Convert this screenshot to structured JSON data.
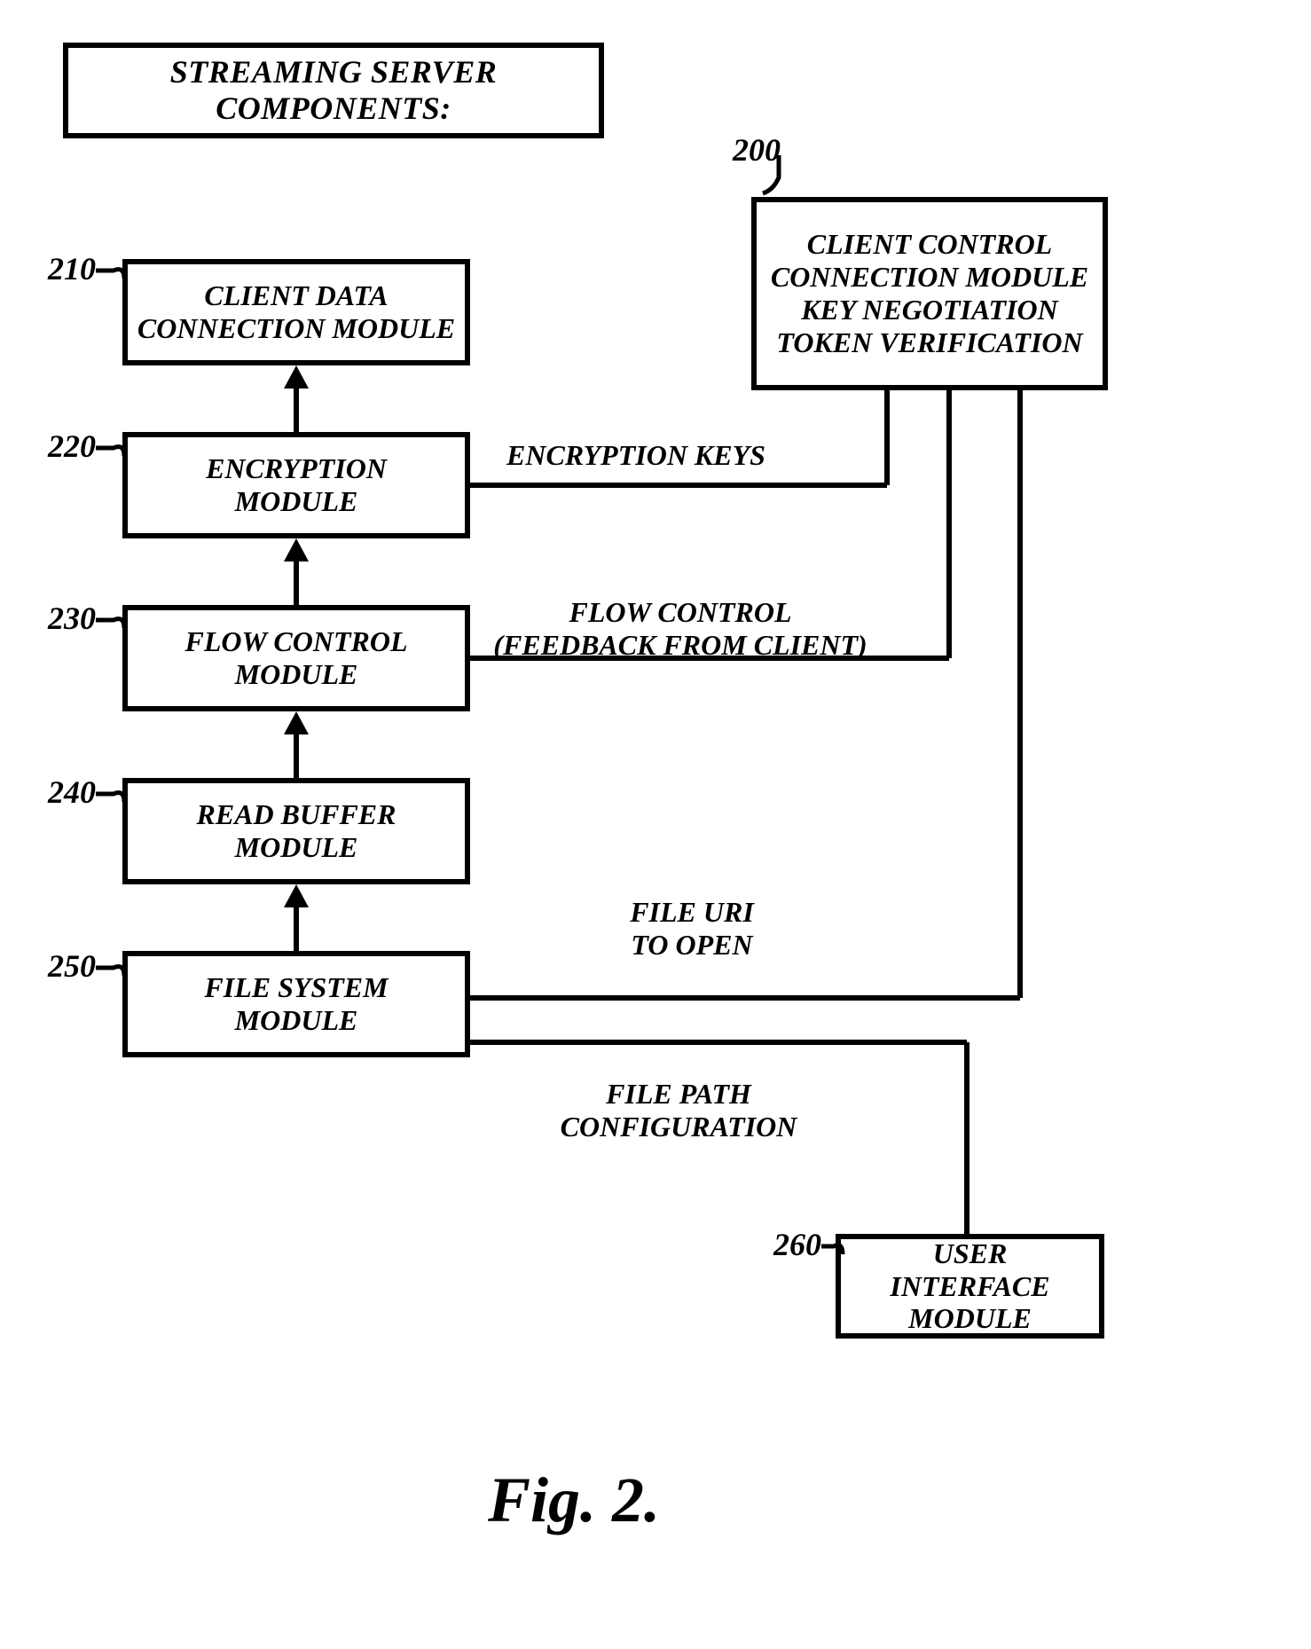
{
  "title": "STREAMING SERVER COMPONENTS:",
  "refs": {
    "client_control": "200",
    "client_data": "210",
    "encryption": "220",
    "flow_control": "230",
    "read_buffer": "240",
    "file_system": "250",
    "user_interface": "260"
  },
  "modules": {
    "client_data": "CLIENT DATA\nCONNECTION MODULE",
    "encryption": "ENCRYPTION\nMODULE",
    "flow_control": "FLOW CONTROL\nMODULE",
    "read_buffer": "READ BUFFER\nMODULE",
    "file_system": "FILE SYSTEM\nMODULE",
    "client_control": "CLIENT CONTROL\nCONNECTION MODULE\nKEY NEGOTIATION\nTOKEN VERIFICATION",
    "user_interface": "USER INTERFACE\nMODULE"
  },
  "edges": {
    "encryption_keys": "ENCRYPTION KEYS",
    "flow_feedback": "FLOW CONTROL\n(FEEDBACK FROM CLIENT)",
    "file_uri": "FILE URI\nTO OPEN",
    "file_path": "FILE PATH\nCONFIGURATION"
  },
  "figure_caption": "Fig. 2."
}
